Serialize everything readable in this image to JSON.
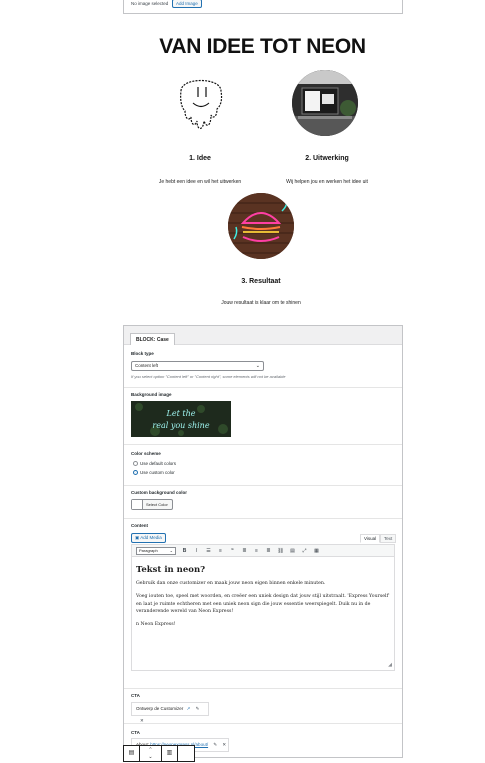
{
  "top_field": {
    "no_image_text": "No image selected",
    "add_image_label": "Add Image"
  },
  "hero": {
    "title": "VAN IDEE TOT NEON",
    "steps": [
      {
        "title": "1. Idee",
        "text": "Je hebt een idee en wil het uitwerken"
      },
      {
        "title": "2. Uitwerking",
        "text": "Wij helpen jou en werken het idee uit"
      },
      {
        "title": "3. Resultaat",
        "text": "Jouw resultaat is klaar om te shinen"
      }
    ]
  },
  "block": {
    "tab_label": "BLOCK: Case",
    "block_type": {
      "label": "Block type",
      "value": "Content left",
      "hint": "If you select option \"Content left\" or \"Content right\", some elements will not be available"
    },
    "background_image": {
      "label": "Background image",
      "image_text_line1": "Let the",
      "image_text_line2": "real you shine"
    },
    "color_scheme": {
      "label": "Color scheme",
      "options": [
        "Use default colors",
        "Use custom color"
      ],
      "selected_index": 1
    },
    "custom_bg": {
      "label": "Custom background color",
      "button_label": "Select Color"
    },
    "content": {
      "label": "Content",
      "add_media": "Add Media",
      "tab_visual": "Visual",
      "tab_text": "Text",
      "format_select": "Paragraph",
      "toolbar_icons": [
        "bold-icon",
        "italic-icon",
        "bullet-list-icon",
        "numbered-list-icon",
        "blockquote-icon",
        "align-left-icon",
        "align-center-icon",
        "align-right-icon",
        "link-icon",
        "read-more-icon",
        "fullscreen-icon",
        "toolbar-toggle-icon"
      ],
      "heading": "Tekst in neon?",
      "paragraph1": "Gebruik dan onze customizer en maak jouw neon eigen binnen enkele minuten.",
      "paragraph2": "Voeg iouten toe, speel met woorden, en creëer een uniek design dat jouw stijl uitstraalt. 'Express Yourself' en laat je ruimte echtheren met een uniek neon sign die jouw essentie weerspiegelt. Duik nu in de veranderende wereld van Neon Express!",
      "paragraph3": "n Neon Express!"
    },
    "cta1": {
      "label": "CTA",
      "text": "Ontwerp de Customizer"
    },
    "cta2": {
      "label": "CTA",
      "prefix": "About:",
      "url": "https://neonexpress.nl/about/"
    }
  },
  "colors": {
    "accent": "#2271b1",
    "neon_pink": "#ff3fa4",
    "neon_cyan": "#3ff0e6"
  }
}
